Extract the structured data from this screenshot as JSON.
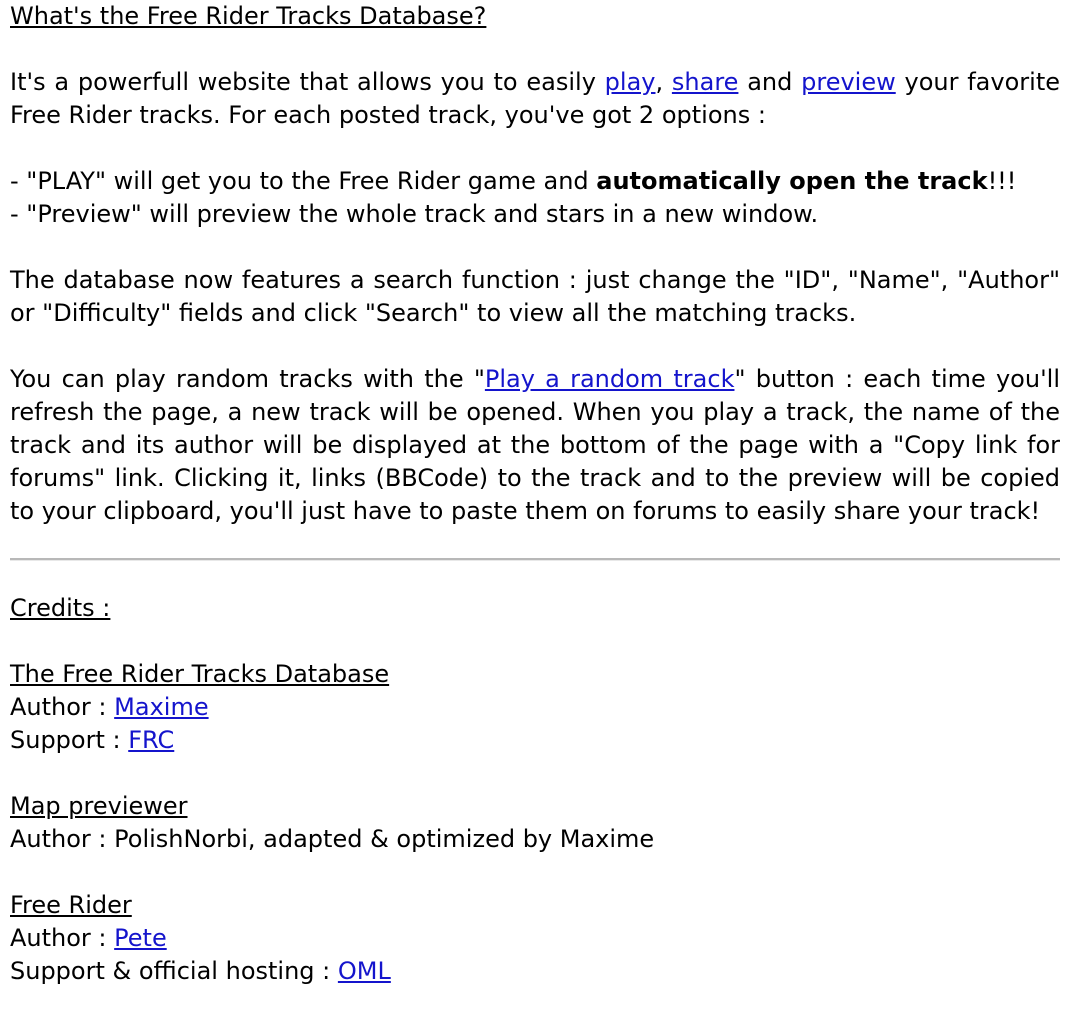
{
  "intro": {
    "heading": "What's the Free Rider Tracks Database?",
    "p1": {
      "t1": "It's a powerfull website that allows you to easily ",
      "link_play": "play",
      "t2": ", ",
      "link_share": "share",
      "t3": " and ",
      "link_preview": "preview",
      "t4": " your favorite Free Rider tracks. For each posted track, you've got 2 options :"
    },
    "option1": {
      "t1": "- \"PLAY\" will get you to the Free Rider game and ",
      "bold": "automatically open the track",
      "t2": "!!!"
    },
    "option2": "- \"Preview\" will preview the whole track and stars in a new window.",
    "p2": "The database now features a search function : just change the \"ID\", \"Name\", \"Author\" or \"Difficulty\" fields and click \"Search\" to view all the matching tracks.",
    "p3": {
      "t1": "You can play random tracks with the \"",
      "link_random": "Play a random track",
      "t2": "\" button : each time you'll refresh the page, a new track will be opened. When you play a track, the name of the track and its author will be displayed at the bottom of the page with a \"Copy link for forums\" link. Clicking it, links (BBCode) to the track and to the preview will be copied to your clipboard, you'll just have to paste them on forums to easily share your track!"
    }
  },
  "credits": {
    "heading": "Credits :",
    "database": {
      "title": "The Free Rider Tracks Database",
      "author_label": "Author : ",
      "author_link": "Maxime",
      "support_label": "Support : ",
      "support_link": "FRC"
    },
    "previewer": {
      "title": "Map previewer",
      "author_text": "Author : PolishNorbi, adapted & optimized by Maxime"
    },
    "freerider": {
      "title": "Free Rider",
      "author_label": "Author : ",
      "author_link": "Pete",
      "hosting_label": "Support & official hosting : ",
      "hosting_link": "OML"
    }
  },
  "colors": {
    "link": "#1414cc",
    "text": "#000000",
    "divider": "#b8b8b8"
  }
}
